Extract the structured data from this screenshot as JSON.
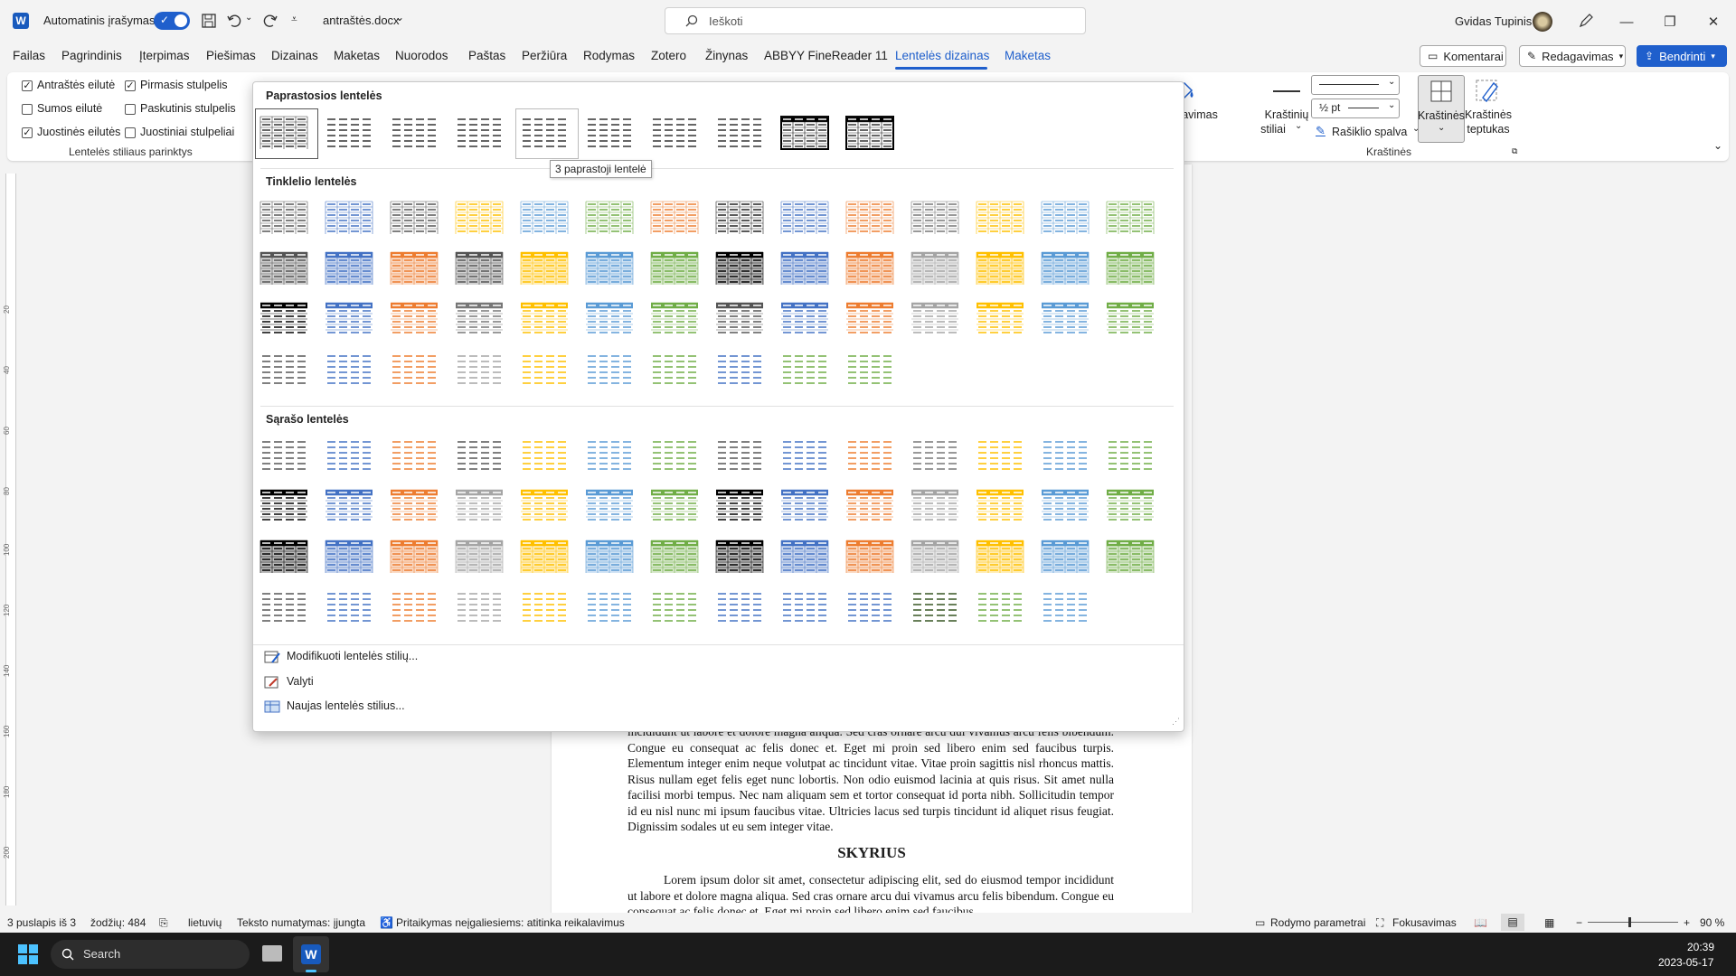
{
  "titlebar": {
    "autosave_label": "Automatinis įrašymas",
    "filename": "antraštės.docx",
    "search_placeholder": "Ieškoti",
    "user_name": "Gvidas Tupinis"
  },
  "menu": [
    "Failas",
    "Pagrindinis",
    "Įterpimas",
    "Piešimas",
    "Dizainas",
    "Maketas",
    "Nuorodos",
    "Paštas",
    "Peržiūra",
    "Rodymas",
    "Zotero",
    "Žinynas",
    "ABBYY FineReader 11",
    "Lentelės dizainas",
    "Maketas"
  ],
  "active_menu_index": 13,
  "topbuttons": {
    "comments": "Komentarai",
    "editing": "Redagavimas",
    "share": "Bendrinti"
  },
  "style_options": {
    "items": [
      {
        "label": "Antraštės eilutė",
        "checked": true
      },
      {
        "label": "Pirmasis stulpelis",
        "checked": true
      },
      {
        "label": "Sumos eilutė",
        "checked": false
      },
      {
        "label": "Paskutinis stulpelis",
        "checked": false
      },
      {
        "label": "Juostinės eilutės",
        "checked": true
      },
      {
        "label": "Juostiniai stulpeliai",
        "checked": false
      }
    ],
    "group_label": "Lentelės stiliaus parinktys"
  },
  "ribbon": {
    "shading": "Šešėliavimas",
    "border_styles_1": "Kraštinių",
    "border_styles_2": "stiliai",
    "pen_weight": "½ pt",
    "pen_color": "Rašiklio spalva",
    "borders": "Kraštinės",
    "border_painter_1": "Kraštinės",
    "border_painter_2": "teptukas",
    "group_label": "Kraštinės"
  },
  "gallery": {
    "sections": [
      "Paprastosios lentelės",
      "Tinklelio lentelės",
      "Sąrašo lentelės"
    ],
    "tooltip": "3 paprastoji lentelė",
    "actions": [
      "Modifikuoti lentelės stilių...",
      "Valyti",
      "Naujas lentelės stilius..."
    ],
    "plain_styles": [
      "plain",
      "plain",
      "plain",
      "plain",
      "plain",
      "plain",
      "plain",
      "plain",
      "black",
      "black"
    ],
    "grid_rows": [
      [
        "#555555",
        "#4472c4",
        "#555555",
        "#ffc000",
        "#5b9bd5",
        "#70ad47",
        "#ed7d31",
        "#222222",
        "#4472c4",
        "#ed7d31",
        "#777777",
        "#ffc000",
        "#5b9bd5",
        "#70ad47"
      ],
      [
        "#555555",
        "#4472c4",
        "#ed7d31",
        "#555555",
        "#ffc000",
        "#5b9bd5",
        "#70ad47",
        "#000000",
        "#4472c4",
        "#ed7d31",
        "#a5a5a5",
        "#ffc000",
        "#5b9bd5",
        "#70ad47"
      ],
      [
        "#000000",
        "#4472c4",
        "#ed7d31",
        "#777777",
        "#ffc000",
        "#5b9bd5",
        "#70ad47",
        "#555555",
        "#4472c4",
        "#ed7d31",
        "#a5a5a5",
        "#ffc000",
        "#5b9bd5",
        "#70ad47"
      ],
      [
        "#555555",
        "#4472c4",
        "#ed7d31",
        "#a5a5a5",
        "#ffc000",
        "#5b9bd5",
        "#70ad47",
        "#4472c4",
        "#70ad47",
        "#70ad47"
      ]
    ],
    "list_rows": [
      [
        "#555555",
        "#4472c4",
        "#ed7d31",
        "#555555",
        "#ffc000",
        "#5b9bd5",
        "#70ad47",
        "#555555",
        "#4472c4",
        "#ed7d31",
        "#777777",
        "#ffc000",
        "#5b9bd5",
        "#70ad47"
      ],
      [
        "#000000",
        "#4472c4",
        "#ed7d31",
        "#a5a5a5",
        "#ffc000",
        "#5b9bd5",
        "#70ad47",
        "#000000",
        "#4472c4",
        "#ed7d31",
        "#a5a5a5",
        "#ffc000",
        "#5b9bd5",
        "#70ad47"
      ],
      [
        "#000000",
        "#4472c4",
        "#ed7d31",
        "#a5a5a5",
        "#ffc000",
        "#5b9bd5",
        "#70ad47",
        "#000000",
        "#4472c4",
        "#ed7d31",
        "#a5a5a5",
        "#ffc000",
        "#5b9bd5",
        "#70ad47"
      ],
      [
        "#555555",
        "#4472c4",
        "#ed7d31",
        "#a5a5a5",
        "#ffc000",
        "#5b9bd5",
        "#70ad47",
        "#4472c4",
        "#4472c4",
        "#4472c4",
        "#375623",
        "#70ad47",
        "#5b9bd5"
      ]
    ]
  },
  "document": {
    "para1": "incididunt ut labore et dolore magna aliqua. Sed cras ornare arcu dui vivamus arcu felis bibendum. Congue eu consequat ac felis donec et. Eget mi proin sed libero enim sed faucibus turpis. Elementum integer enim neque volutpat ac tincidunt vitae. Vitae proin sagittis nisl rhoncus mattis. Risus nullam eget felis eget nunc lobortis. Non odio euismod lacinia at quis risus. Sit amet nulla facilisi morbi tempus. Nec nam aliquam sem et tortor consequat id porta nibh. Sollicitudin tempor id eu nisl nunc mi ipsum faucibus vitae. Ultricies lacus sed turpis tincidunt id aliquet risus feugiat. Dignissim sodales ut eu sem integer vitae.",
    "heading": "SKYRIUS",
    "para2": "Lorem ipsum dolor sit amet, consectetur adipiscing elit, sed do eiusmod tempor incididunt ut labore et dolore magna aliqua. Sed cras ornare arcu dui vivamus arcu felis bibendum. Congue eu consequat ac felis donec et. Eget mi proin sed libero enim sed faucibus"
  },
  "ruler_labels": [
    "20",
    "40",
    "60",
    "80",
    "100",
    "120",
    "140",
    "160",
    "180",
    "200"
  ],
  "status": {
    "page": "3 puslapis iš 3",
    "words": "žodžių: 484",
    "language": "lietuvių",
    "prediction": "Teksto numatymas: įjungta",
    "accessibility": "Pritaikymas neįgaliesiems: atitinka reikalavimus",
    "display": "Rodymo parametrai",
    "focus": "Fokusavimas",
    "zoom": "90 %"
  },
  "taskbar": {
    "search": "Search",
    "time": "20:39",
    "date": "2023-05-17"
  },
  "colors": {
    "accent": "#1f5fcc"
  }
}
